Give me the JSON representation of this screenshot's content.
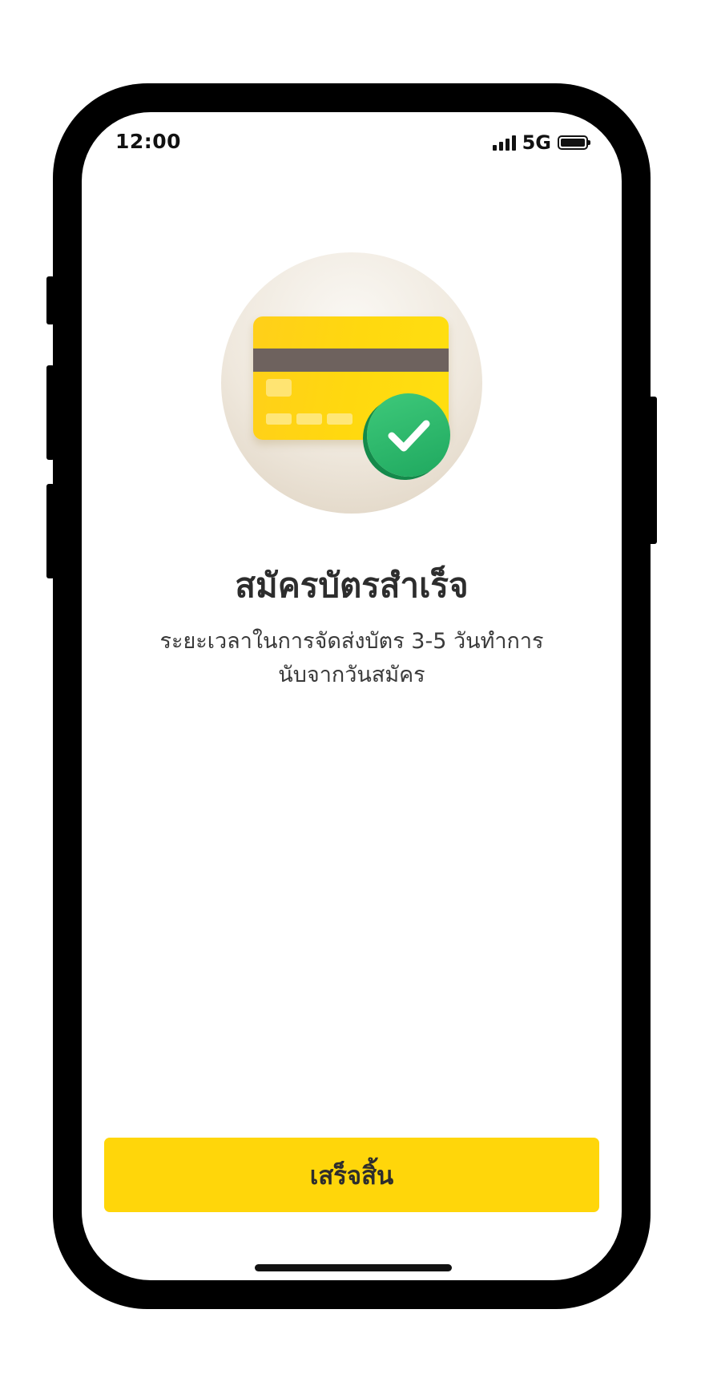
{
  "status_bar": {
    "time": "12:00",
    "network": "5G",
    "signal_icon": "signal-bars-icon",
    "battery_icon": "battery-full-icon"
  },
  "illustration": {
    "card_icon": "credit-card-icon",
    "check_icon": "checkmark-circle-icon",
    "colors": {
      "card": "#FFD60A",
      "stripe": "#6E625E",
      "check": "#22B366",
      "background": "#EFE8DD"
    }
  },
  "result": {
    "title": "สมัครบัตรสำเร็จ",
    "subtitle_line1": "ระยะเวลาในการจัดส่งบัตร 3-5 วันทำการ",
    "subtitle_line2": "นับจากวันสมัคร"
  },
  "actions": {
    "done_label": "เสร็จสิ้น",
    "button_color": "#FFD60A"
  }
}
